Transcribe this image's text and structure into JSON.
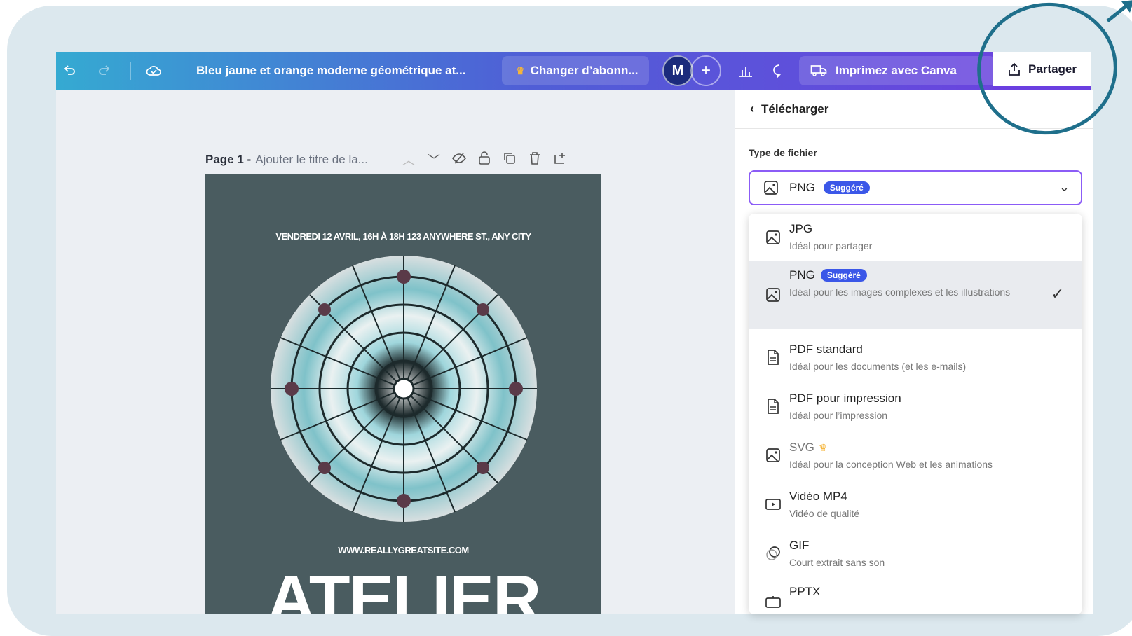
{
  "topbar": {
    "doc_title": "Bleu jaune et orange moderne géométrique at...",
    "upgrade_label": "Changer d’abonn...",
    "avatar_initial": "M",
    "print_label": "Imprimez avec Canva",
    "share_label": "Partager"
  },
  "page_header": {
    "page_label": "Page 1 -",
    "page_title_placeholder": "Ajouter le titre de la..."
  },
  "poster": {
    "date_line": "VENDREDI 12 AVRIL, 16H À 18H     123 ANYWHERE ST., ANY CITY",
    "website": "WWW.REALLYGREATSITE.COM",
    "title": "ATELIER"
  },
  "download_panel": {
    "header": "Télécharger",
    "file_type_label": "Type de fichier",
    "selected": {
      "name": "PNG",
      "badge": "Suggéré",
      "icon": "image-icon"
    },
    "options": [
      {
        "name": "JPG",
        "desc": "Idéal pour partager",
        "icon": "image-icon"
      },
      {
        "name": "PNG",
        "badge": "Suggéré",
        "desc": "Idéal pour les images complexes et les illustrations",
        "icon": "image-icon",
        "selected": true
      },
      {
        "name": "PDF standard",
        "desc": "Idéal pour les documents (et les e-mails)",
        "icon": "document-icon"
      },
      {
        "name": "PDF pour impression",
        "desc": "Idéal pour l’impression",
        "icon": "document-icon"
      },
      {
        "name": "SVG",
        "desc": "Idéal pour la conception Web et les animations",
        "icon": "image-icon",
        "premium": true
      },
      {
        "name": "Vidéo MP4",
        "desc": "Vidéo de qualité",
        "icon": "video-icon"
      },
      {
        "name": "GIF",
        "desc": "Court extrait sans son",
        "icon": "gif-icon"
      },
      {
        "name": "PPTX",
        "desc": "",
        "icon": "presentation-icon"
      }
    ]
  },
  "colors": {
    "accent_purple": "#6b3fe0",
    "badge_blue": "#3b57e8",
    "annotation_teal": "#1f6f8b",
    "poster_bg": "#4a5c60"
  }
}
